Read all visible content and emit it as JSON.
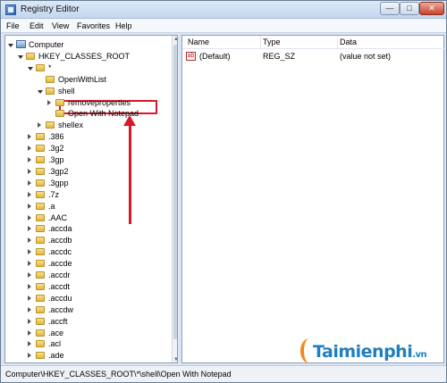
{
  "window": {
    "title": "Registry Editor"
  },
  "controls": {
    "minimize": "—",
    "maximize": "□",
    "close": "✕"
  },
  "menu": [
    "File",
    "Edit",
    "View",
    "Favorites",
    "Help"
  ],
  "tree": {
    "rows": [
      {
        "label": "Computer",
        "indent": 0,
        "expander": "expanded",
        "icon": "computer-icon"
      },
      {
        "label": "HKEY_CLASSES_ROOT",
        "indent": 1,
        "expander": "expanded",
        "icon": "folder-icon"
      },
      {
        "label": "*",
        "indent": 2,
        "expander": "expanded",
        "icon": "folder-icon"
      },
      {
        "label": "OpenWithList",
        "indent": 3,
        "expander": "none",
        "icon": "folder-icon"
      },
      {
        "label": "shell",
        "indent": 3,
        "expander": "expanded",
        "icon": "folder-icon"
      },
      {
        "label": "removeproperties",
        "indent": 4,
        "expander": "collapsed",
        "icon": "folder-icon"
      },
      {
        "label": "Open With Notepad",
        "indent": 4,
        "expander": "none",
        "icon": "folder-icon",
        "selected": true
      },
      {
        "label": "shellex",
        "indent": 3,
        "expander": "collapsed",
        "icon": "folder-icon"
      },
      {
        "label": ".386",
        "indent": 2,
        "expander": "collapsed",
        "icon": "folder-icon"
      },
      {
        "label": ".3g2",
        "indent": 2,
        "expander": "collapsed",
        "icon": "folder-icon"
      },
      {
        "label": ".3gp",
        "indent": 2,
        "expander": "collapsed",
        "icon": "folder-icon"
      },
      {
        "label": ".3gp2",
        "indent": 2,
        "expander": "collapsed",
        "icon": "folder-icon"
      },
      {
        "label": ".3gpp",
        "indent": 2,
        "expander": "collapsed",
        "icon": "folder-icon"
      },
      {
        "label": ".7z",
        "indent": 2,
        "expander": "collapsed",
        "icon": "folder-icon"
      },
      {
        "label": ".a",
        "indent": 2,
        "expander": "collapsed",
        "icon": "folder-icon"
      },
      {
        "label": ".AAC",
        "indent": 2,
        "expander": "collapsed",
        "icon": "folder-icon"
      },
      {
        "label": ".accda",
        "indent": 2,
        "expander": "collapsed",
        "icon": "folder-icon"
      },
      {
        "label": ".accdb",
        "indent": 2,
        "expander": "collapsed",
        "icon": "folder-icon"
      },
      {
        "label": ".accdc",
        "indent": 2,
        "expander": "collapsed",
        "icon": "folder-icon"
      },
      {
        "label": ".accde",
        "indent": 2,
        "expander": "collapsed",
        "icon": "folder-icon"
      },
      {
        "label": ".accdr",
        "indent": 2,
        "expander": "collapsed",
        "icon": "folder-icon"
      },
      {
        "label": ".accdt",
        "indent": 2,
        "expander": "collapsed",
        "icon": "folder-icon"
      },
      {
        "label": ".accdu",
        "indent": 2,
        "expander": "collapsed",
        "icon": "folder-icon"
      },
      {
        "label": ".accdw",
        "indent": 2,
        "expander": "collapsed",
        "icon": "folder-icon"
      },
      {
        "label": ".accft",
        "indent": 2,
        "expander": "collapsed",
        "icon": "folder-icon"
      },
      {
        "label": ".ace",
        "indent": 2,
        "expander": "collapsed",
        "icon": "folder-icon"
      },
      {
        "label": ".acl",
        "indent": 2,
        "expander": "collapsed",
        "icon": "folder-icon"
      },
      {
        "label": ".ade",
        "indent": 2,
        "expander": "collapsed",
        "icon": "folder-icon"
      }
    ]
  },
  "list": {
    "headers": {
      "name": "Name",
      "type": "Type",
      "data": "Data"
    },
    "rows": [
      {
        "icon": "ab",
        "name": "(Default)",
        "type": "REG_SZ",
        "data": "(value not set)"
      }
    ]
  },
  "status": {
    "path": "Computer\\HKEY_CLASSES_ROOT\\*\\shell\\Open With Notepad"
  },
  "watermark": {
    "brand": "Taimienphi",
    "suffix": ".vn"
  },
  "colors": {
    "highlight": "#d9182a",
    "watermark": "#1f7fc0",
    "watermark_accent": "#f08a1c"
  }
}
